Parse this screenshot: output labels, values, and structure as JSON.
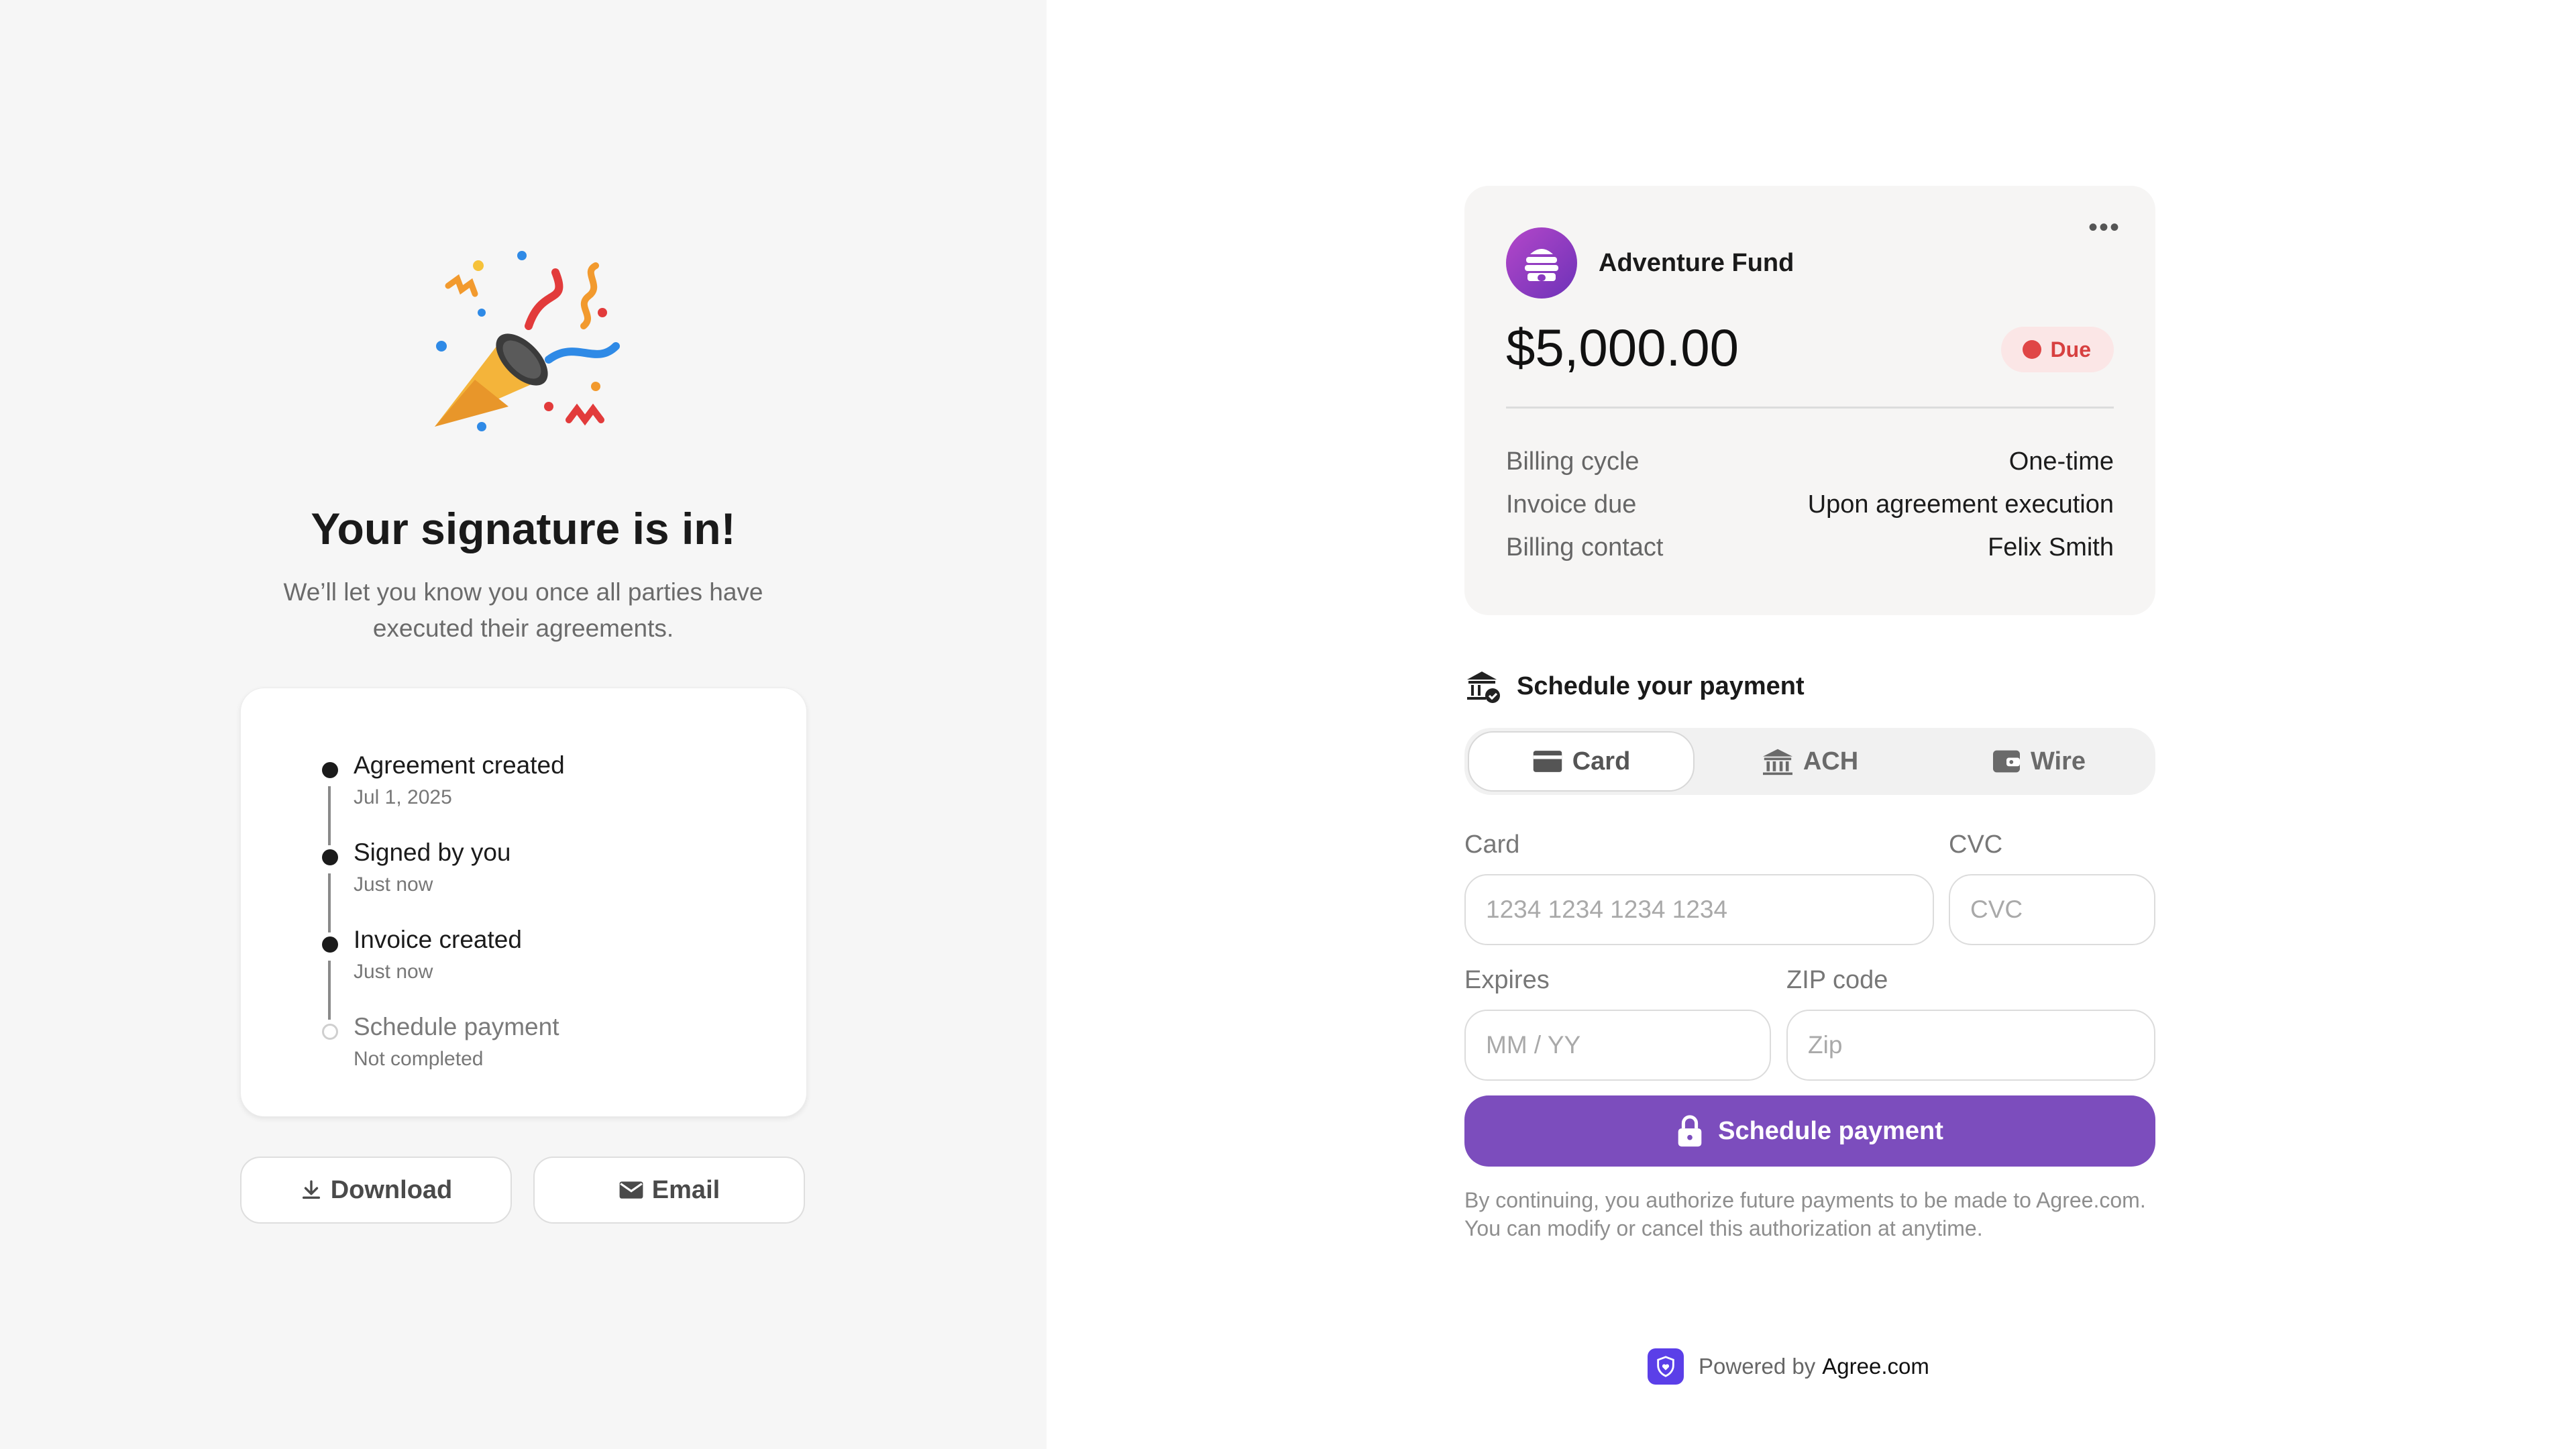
{
  "confirmation": {
    "illustration": "party-popper-icon",
    "title": "Your signature is in!",
    "subtitle": "We’ll let you know you once all parties have executed their agreements."
  },
  "timeline": [
    {
      "title": "Agreement created",
      "subtitle": "Jul 1, 2025",
      "completed": true
    },
    {
      "title": "Signed by you",
      "subtitle": "Just now",
      "completed": true
    },
    {
      "title": "Invoice created",
      "subtitle": "Just now",
      "completed": true
    },
    {
      "title": "Schedule payment",
      "subtitle": "Not completed",
      "completed": false
    }
  ],
  "actions": {
    "download_label": "Download",
    "email_label": "Email"
  },
  "invoice": {
    "payee": "Adventure Fund",
    "amount": "$5,000.00",
    "status": "Due",
    "details": [
      {
        "label": "Billing cycle",
        "value": "One-time"
      },
      {
        "label": "Invoice due",
        "value": "Upon agreement execution"
      },
      {
        "label": "Billing contact",
        "value": "Felix Smith"
      }
    ]
  },
  "payment": {
    "heading": "Schedule your payment",
    "tabs": [
      {
        "label": "Card",
        "icon": "card-icon",
        "active": true
      },
      {
        "label": "ACH",
        "icon": "bank-icon",
        "active": false
      },
      {
        "label": "Wire",
        "icon": "wallet-icon",
        "active": false
      }
    ],
    "fields": {
      "card": {
        "label": "Card",
        "placeholder": "1234 1234 1234 1234"
      },
      "cvc": {
        "label": "CVC",
        "placeholder": "CVC"
      },
      "expires": {
        "label": "Expires",
        "placeholder": "MM / YY"
      },
      "zip": {
        "label": "ZIP code",
        "placeholder": "Zip"
      }
    },
    "submit_label": "Schedule payment",
    "legal": "By continuing, you authorize future payments to be made to Agree.com. You can modify or cancel this authorization at anytime."
  },
  "footer": {
    "powered_prefix": "Powered by",
    "brand": "Agree.com"
  },
  "colors": {
    "accent": "#7c4dbd",
    "due_badge_bg": "#fbe6e6",
    "due_badge_text": "#d74040",
    "left_panel_bg": "#f6f6f6"
  }
}
